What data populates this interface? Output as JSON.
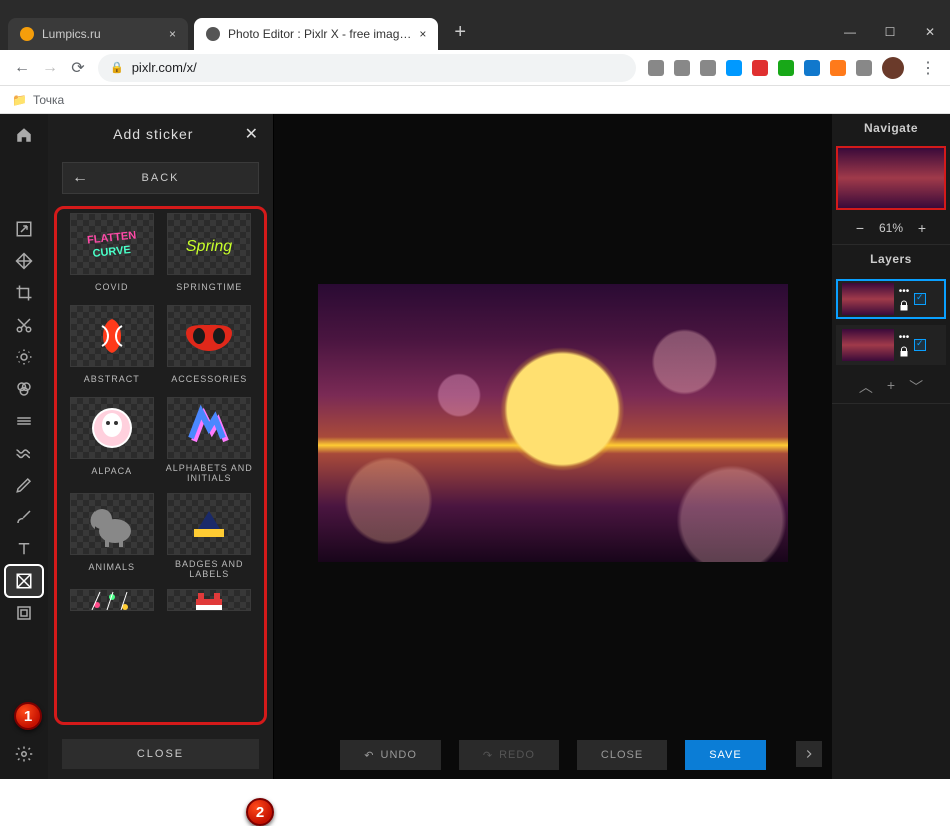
{
  "browser": {
    "tabs": [
      {
        "title": "Lumpics.ru",
        "active": false,
        "favicon_color": "#f59e0b"
      },
      {
        "title": "Photo Editor : Pixlr X - free imag…",
        "active": true,
        "favicon_color": "#555"
      }
    ],
    "url": "pixlr.com/x/",
    "bookmark_folder": "Точка",
    "ext_icons": [
      "#888",
      "#888",
      "#888",
      "#0099ff",
      "#e03030",
      "#18a818",
      "#1178cc",
      "#ff7a1a",
      "#888"
    ]
  },
  "app": {
    "panel": {
      "title": "Add sticker",
      "back_label": "BACK",
      "close_label": "CLOSE",
      "categories": [
        {
          "label": "COVID"
        },
        {
          "label": "SPRINGTIME"
        },
        {
          "label": "ABSTRACT"
        },
        {
          "label": "ACCESSORIES"
        },
        {
          "label": "ALPACA"
        },
        {
          "label": "ALPHABETS AND INITIALS"
        },
        {
          "label": "ANIMALS"
        },
        {
          "label": "BADGES AND LABELS"
        }
      ]
    },
    "bottom": {
      "undo": "UNDO",
      "redo": "REDO",
      "close": "CLOSE",
      "save": "SAVE"
    },
    "right": {
      "navigate": "Navigate",
      "zoom": "61%",
      "layers": "Layers"
    },
    "markers": {
      "one": "1",
      "two": "2"
    }
  }
}
